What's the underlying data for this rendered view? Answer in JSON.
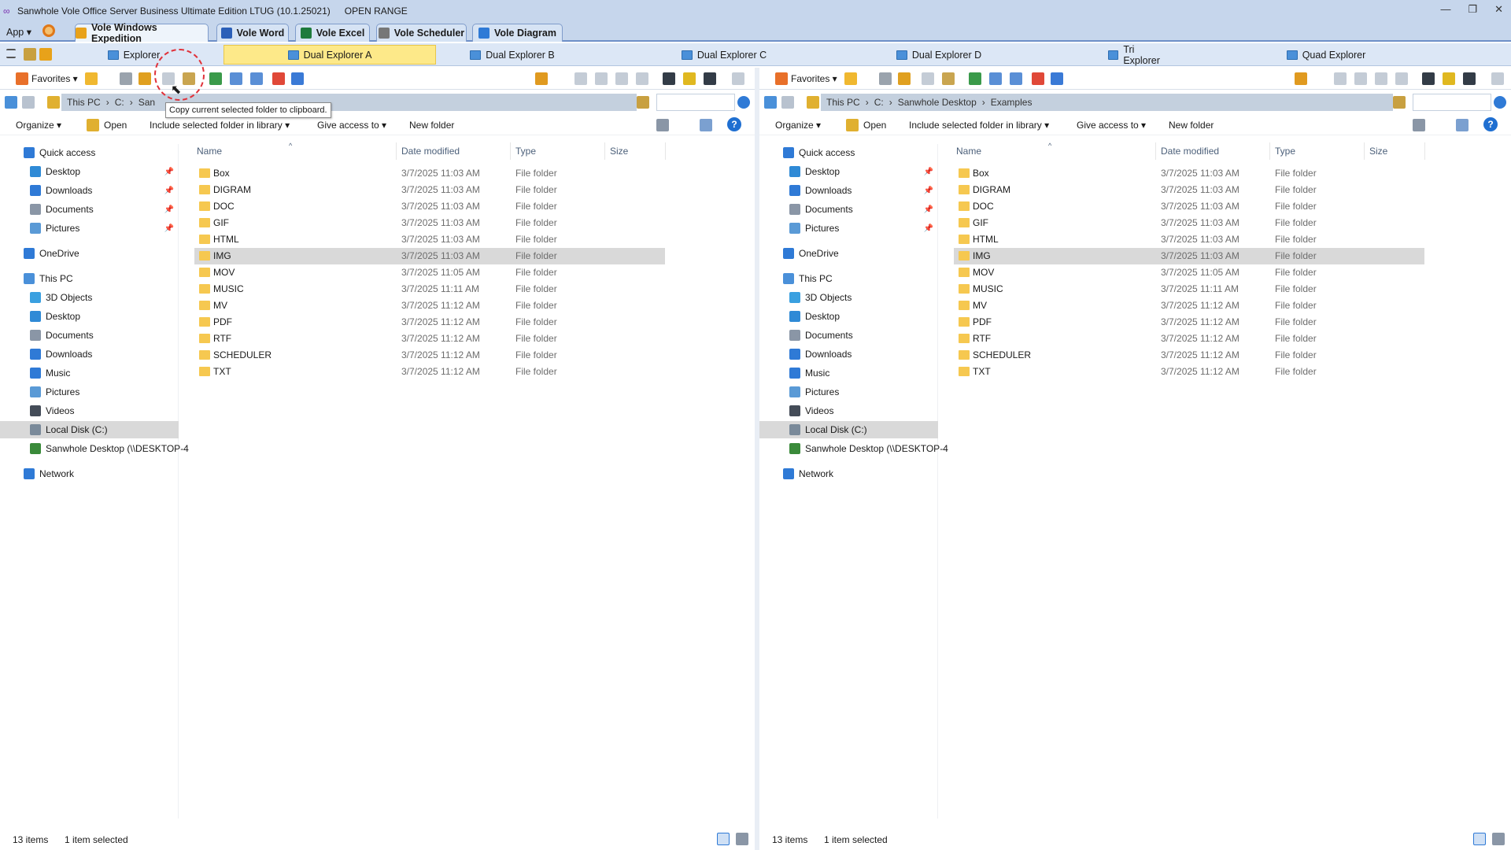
{
  "title": "Sanwhole Vole Office Server Business Ultimate Edition LTUG (10.1.25021)",
  "range_label": "OPEN RANGE",
  "window_buttons": [
    "—",
    "❐",
    "✕"
  ],
  "app_menu": "App ▾",
  "app_tabs": [
    {
      "label": "Vole Windows Expedition",
      "icon": "explorer-icon",
      "color": "#e8a21a"
    },
    {
      "label": "Vole Word",
      "icon": "word-icon",
      "color": "#2b5fb8"
    },
    {
      "label": "Vole Excel",
      "icon": "excel-icon",
      "color": "#1e7b3c"
    },
    {
      "label": "Vole Scheduler",
      "icon": "scheduler-icon",
      "color": "#777777"
    },
    {
      "label": "Vole Diagram",
      "icon": "diagram-icon",
      "color": "#2f7ad6"
    }
  ],
  "modes": [
    "Explorer",
    "Dual Explorer A",
    "Dual Explorer B",
    "Dual Explorer C",
    "Dual Explorer D",
    "Tri Explorer",
    "Quad Explorer"
  ],
  "active_mode": "Dual Explorer A",
  "toolbar": {
    "favorites": "Favorites ▾"
  },
  "tooltip": "Copy current selected folder to clipboard.",
  "left": {
    "crumbs": [
      "This PC",
      "C:",
      "San"
    ],
    "status": {
      "count": "13 items",
      "selected": "1 item selected"
    }
  },
  "right": {
    "crumbs": [
      "This PC",
      "C:",
      "Sanwhole Desktop",
      "Examples"
    ],
    "status": {
      "count": "13 items",
      "selected": "1 item selected"
    }
  },
  "commands": {
    "organize": "Organize ▾",
    "open": "Open",
    "include": "Include selected folder in library ▾",
    "give": "Give access to ▾",
    "newfolder": "New folder",
    "help": "?"
  },
  "nav": [
    {
      "label": "Quick access",
      "icon": "star-icon",
      "indent": 1
    },
    {
      "label": "Desktop",
      "icon": "desktop-icon",
      "indent": 2,
      "pin": "📌"
    },
    {
      "label": "Downloads",
      "icon": "downloads-icon",
      "indent": 2,
      "pin": "📌"
    },
    {
      "label": "Documents",
      "icon": "documents-icon",
      "indent": 2,
      "pin": "📌"
    },
    {
      "label": "Pictures",
      "icon": "pictures-icon",
      "indent": 2,
      "pin": "📌"
    },
    {
      "label": "OneDrive",
      "icon": "cloud-icon",
      "indent": 1
    },
    {
      "label": "This PC",
      "icon": "computer-icon",
      "indent": 1
    },
    {
      "label": "3D Objects",
      "icon": "cube-icon",
      "indent": 2
    },
    {
      "label": "Desktop",
      "icon": "desktop-icon",
      "indent": 2
    },
    {
      "label": "Documents",
      "icon": "documents-icon",
      "indent": 2
    },
    {
      "label": "Downloads",
      "icon": "downloads-icon",
      "indent": 2
    },
    {
      "label": "Music",
      "icon": "music-icon",
      "indent": 2
    },
    {
      "label": "Pictures",
      "icon": "pictures-icon",
      "indent": 2
    },
    {
      "label": "Videos",
      "icon": "videos-icon",
      "indent": 2
    },
    {
      "label": "Local Disk (C:)",
      "icon": "disk-icon",
      "indent": 2,
      "selected": true
    },
    {
      "label": "Sanwhole Desktop (\\\\DESKTOP-4",
      "icon": "network-drive-icon",
      "indent": 2
    },
    {
      "label": "Network",
      "icon": "network-icon",
      "indent": 1
    }
  ],
  "columns": [
    "Name",
    "Date modified",
    "Type",
    "Size"
  ],
  "files": [
    {
      "name": "Box",
      "date": "3/7/2025 11:03 AM",
      "type": "File folder"
    },
    {
      "name": "DIGRAM",
      "date": "3/7/2025 11:03 AM",
      "type": "File folder"
    },
    {
      "name": "DOC",
      "date": "3/7/2025 11:03 AM",
      "type": "File folder"
    },
    {
      "name": "GIF",
      "date": "3/7/2025 11:03 AM",
      "type": "File folder"
    },
    {
      "name": "HTML",
      "date": "3/7/2025 11:03 AM",
      "type": "File folder"
    },
    {
      "name": "IMG",
      "date": "3/7/2025 11:03 AM",
      "type": "File folder",
      "selected": true
    },
    {
      "name": "MOV",
      "date": "3/7/2025 11:05 AM",
      "type": "File folder"
    },
    {
      "name": "MUSIC",
      "date": "3/7/2025 11:11 AM",
      "type": "File folder"
    },
    {
      "name": "MV",
      "date": "3/7/2025 11:12 AM",
      "type": "File folder"
    },
    {
      "name": "PDF",
      "date": "3/7/2025 11:12 AM",
      "type": "File folder"
    },
    {
      "name": "RTF",
      "date": "3/7/2025 11:12 AM",
      "type": "File folder"
    },
    {
      "name": "SCHEDULER",
      "date": "3/7/2025 11:12 AM",
      "type": "File folder"
    },
    {
      "name": "TXT",
      "date": "3/7/2025 11:12 AM",
      "type": "File folder"
    }
  ]
}
